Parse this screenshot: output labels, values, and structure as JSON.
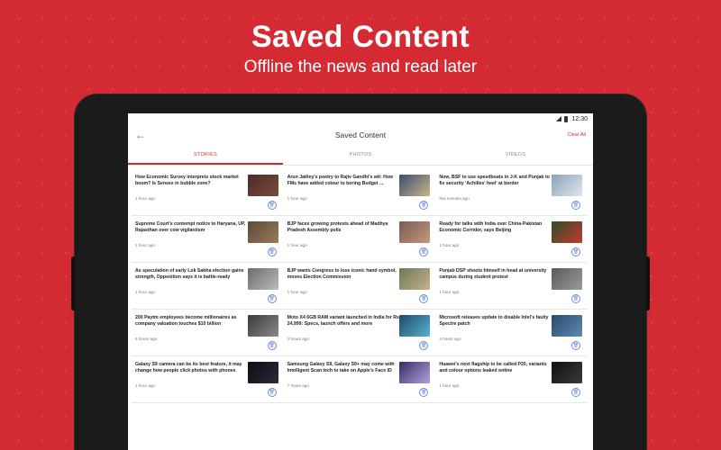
{
  "promo": {
    "title": "Saved Content",
    "subtitle": "Offline the news and read later"
  },
  "statusbar": {
    "time": "12:30"
  },
  "appbar": {
    "title": "Saved Content",
    "clear_all": "Clear All"
  },
  "tabs": [
    {
      "label": "STORIES",
      "active": true
    },
    {
      "label": "PHOTOS",
      "active": false
    },
    {
      "label": "VIDEOS",
      "active": false
    }
  ],
  "stories": [
    {
      "headline": "How Economic Survey interprets stock market boom? Is Sensex in bubble zone?",
      "time": "1 hour ago",
      "thumb": [
        "#4a2d2a",
        "#7a4a3a"
      ]
    },
    {
      "headline": "Arun Jaitley's poetry to Rajiv Gandhi's wit: How FMs have added colour to boring Budget ...",
      "time": "1 hour ago",
      "thumb": [
        "#3b4d6b",
        "#c8b58a"
      ]
    },
    {
      "headline": "Now, BSF to use speedboats in J-K and Punjab to fix security 'Achilles' heel' at border",
      "time": "few minutes ago",
      "thumb": [
        "#8aa3b8",
        "#dfe6ec"
      ]
    },
    {
      "headline": "Supreme Court's contempt notice to Haryana, UP, Rajasthan over cow vigilantism",
      "time": "1 hour ago",
      "thumb": [
        "#5a4a3a",
        "#9b7a5a"
      ]
    },
    {
      "headline": "BJP faces growing protests ahead of Madhya Pradesh Assembly polls",
      "time": "1 hour ago",
      "thumb": [
        "#7a5a55",
        "#c49a7a"
      ]
    },
    {
      "headline": "Ready for talks with India over China-Pakistan Economic Corridor, says Beijing",
      "time": "1 hour ago",
      "thumb": [
        "#2e4d2e",
        "#c43a2a"
      ]
    },
    {
      "headline": "As speculation of early Lok Sabha election gains strength, Opposition says it is battle-ready",
      "time": "1 hour ago",
      "thumb": [
        "#6b6b6b",
        "#bcbcbc"
      ]
    },
    {
      "headline": "BJP wants Congress to lose iconic hand symbol, moves Election Commission",
      "time": "1 hour ago",
      "thumb": [
        "#6a7a5a",
        "#c9b08a"
      ]
    },
    {
      "headline": "Punjab DSP shoots himself in head at university campus during student protest",
      "time": "1 hour ago",
      "thumb": [
        "#5a5a5a",
        "#9a9a9a"
      ]
    },
    {
      "headline": "200 Paytm employees become millionaires as company valuation touches $10 billion",
      "time": "6 hours ago",
      "thumb": [
        "#3a3a3a",
        "#8a8a8a"
      ]
    },
    {
      "headline": "Moto X4 6GB RAM variant launched in India for Rs 24,999: Specs, launch offers and more",
      "time": "3 hours ago",
      "thumb": [
        "#1e4a6a",
        "#5ab0d0"
      ]
    },
    {
      "headline": "Microsoft releases update to disable Intel's faulty Spectre patch",
      "time": "4 hours ago",
      "thumb": [
        "#2a4a6a",
        "#5a8ab0"
      ]
    },
    {
      "headline": "Galaxy S9 camera can be its best feature, it may change how people click photos with phones",
      "time": "1 hour ago",
      "thumb": [
        "#0e0e14",
        "#2a2a3a"
      ]
    },
    {
      "headline": "Samsung Galaxy S9, Galaxy S9+ may come with Intelligent Scan tech to take on Apple's Face ID",
      "time": "7 hours ago",
      "thumb": [
        "#3a2a6a",
        "#b0a0d8"
      ]
    },
    {
      "headline": "Huawei's next flagship to be called P20, variants and colour options leaked online",
      "time": "1 hour ago",
      "thumb": [
        "#101010",
        "#3a3a3a"
      ]
    }
  ]
}
